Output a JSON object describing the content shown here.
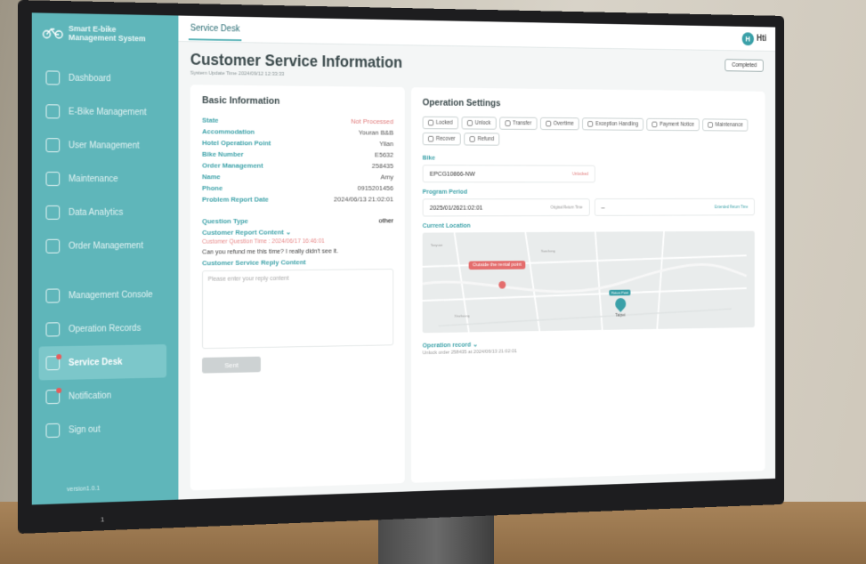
{
  "app": {
    "brand_line1": "Smart E-bike",
    "brand_line2": "Management System",
    "version": "version1.0.1"
  },
  "sidebar": {
    "items": [
      {
        "label": "Dashboard",
        "icon": "dashboard-icon"
      },
      {
        "label": "E-Bike Management",
        "icon": "bike-icon"
      },
      {
        "label": "User Management",
        "icon": "users-icon"
      },
      {
        "label": "Maintenance",
        "icon": "wrench-icon"
      },
      {
        "label": "Data Analytics",
        "icon": "chart-icon"
      },
      {
        "label": "Order Management",
        "icon": "document-icon"
      },
      {
        "label": "Management Console",
        "icon": "gear-icon"
      },
      {
        "label": "Operation Records",
        "icon": "history-icon"
      },
      {
        "label": "Service Desk",
        "icon": "service-icon",
        "active": true
      },
      {
        "label": "Notification",
        "icon": "bell-icon"
      },
      {
        "label": "Sign out",
        "icon": "logout-icon"
      }
    ]
  },
  "topbar": {
    "tab": "Service Desk",
    "avatar_letter": "H",
    "user": "Hti"
  },
  "header": {
    "title": "Customer Service Information",
    "subtitle": "System Update Time 2024/09/12 12:33:33",
    "status_button": "Completed"
  },
  "basic_info": {
    "title": "Basic Information",
    "fields": [
      {
        "key": "State",
        "value": "Not Processed",
        "red": true
      },
      {
        "key": "Accommodation",
        "value": "Youran B&B"
      },
      {
        "key": "Hotel Operation Point",
        "value": "Yilan"
      },
      {
        "key": "Bike Number",
        "value": "E5632"
      },
      {
        "key": "Order Management",
        "value": "258435"
      },
      {
        "key": "Name",
        "value": "Amy"
      },
      {
        "key": "Phone",
        "value": "0915201456"
      },
      {
        "key": "Problem Report Date",
        "value": "2024/06/13 21:02:01"
      }
    ],
    "question_type_label": "Question Type",
    "question_type_value": "other",
    "report_content_label": "Customer Report Content",
    "question_time": "Customer Question Time : 2024/06/17 16:46:01",
    "question_text": "Can you refund me this time? I really didn't see it.",
    "reply_label": "Customer Service Reply Content",
    "reply_placeholder": "Please enter your reply content",
    "send_label": "Sent"
  },
  "operation": {
    "title": "Operation Settings",
    "buttons": [
      "Locked",
      "Unlock",
      "Transfer",
      "Overtime",
      "Exception Handling",
      "Payment Notice",
      "Maintenance",
      "Recover",
      "Refund"
    ],
    "bike_label": "Bike",
    "bike_value": "EPCG10866-NW",
    "bike_tag": "Unlocked",
    "period_label": "Program Period",
    "period_value": "2025/01/2621:02:01",
    "period_hint1": "Original Return Time",
    "period_value2": "--",
    "period_hint2": "Extended Return Time",
    "location_label": "Current Location",
    "map_bubble": "Outside the rental point",
    "map_pin_label": "Return Point",
    "map_city": "Taipei",
    "map_places": [
      "Taoyuan",
      "Sanchong",
      "Xinzhuang"
    ],
    "record_label": "Operation record",
    "record_text": "Unlock order 258435 at 2024/06/13 21:02:01"
  },
  "colors": {
    "sidebar": "#5fb6ba",
    "accent": "#3fa3aa",
    "alert": "#e46d6d"
  }
}
